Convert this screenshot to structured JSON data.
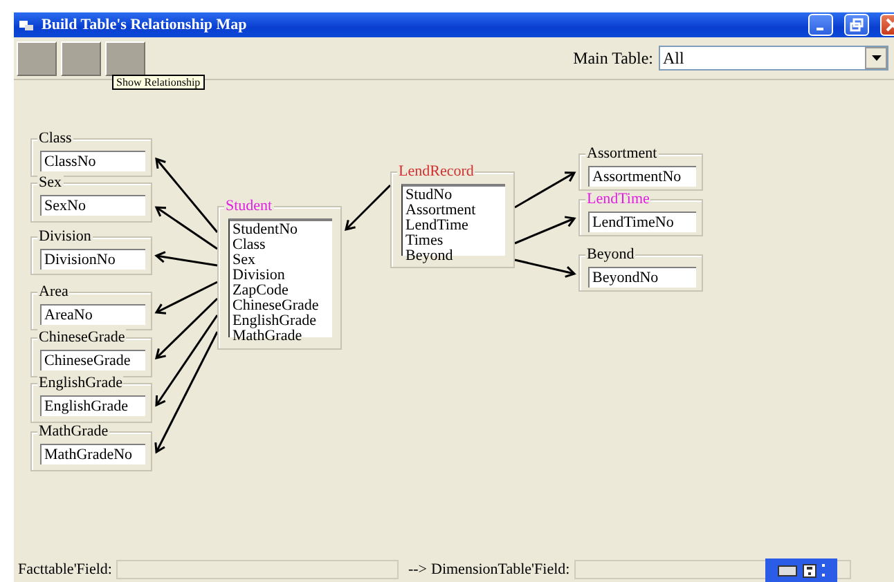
{
  "window": {
    "title": "Build Table's Relationship Map"
  },
  "toolbar": {
    "tooltip": "Show Relationship"
  },
  "main_table": {
    "label": "Main Table:",
    "value": "All"
  },
  "diagram": {
    "tables": [
      {
        "title": "Class",
        "color": "#000000",
        "kind": "field",
        "fields": [
          "ClassNo"
        ]
      },
      {
        "title": "Sex",
        "color": "#000000",
        "kind": "field",
        "fields": [
          "SexNo"
        ]
      },
      {
        "title": "Division",
        "color": "#000000",
        "kind": "field",
        "fields": [
          "DivisionNo"
        ]
      },
      {
        "title": "Area",
        "color": "#000000",
        "kind": "field",
        "fields": [
          "AreaNo"
        ]
      },
      {
        "title": "ChineseGrade",
        "color": "#000000",
        "kind": "field",
        "fields": [
          "ChineseGrade"
        ]
      },
      {
        "title": "EnglishGrade",
        "color": "#000000",
        "kind": "field",
        "fields": [
          "EnglishGrade"
        ]
      },
      {
        "title": "MathGrade",
        "color": "#000000",
        "kind": "field",
        "fields": [
          "MathGradeNo"
        ]
      },
      {
        "title": "Student",
        "color": "#e020e0",
        "kind": "list",
        "fields": [
          "StudentNo",
          "Class",
          "Sex",
          "Division",
          "ZapCode",
          "ChineseGrade",
          "EnglishGrade",
          "MathGrade"
        ]
      },
      {
        "title": "LendRecord",
        "color": "#d03030",
        "kind": "list",
        "fields": [
          "StudNo",
          "Assortment",
          "LendTime",
          "Times",
          "Beyond"
        ]
      },
      {
        "title": "Assortment",
        "color": "#000000",
        "kind": "field",
        "fields": [
          "AssortmentNo"
        ]
      },
      {
        "title": "LendTime",
        "color": "#e020e0",
        "kind": "field",
        "fields": [
          "LendTimeNo"
        ]
      },
      {
        "title": "Beyond",
        "color": "#000000",
        "kind": "field",
        "fields": [
          "BeyondNo"
        ]
      }
    ]
  },
  "status": {
    "fact_label": "Facttable'Field:",
    "arrow_text": "-->",
    "dimension_label": "DimensionTable'Field:"
  }
}
